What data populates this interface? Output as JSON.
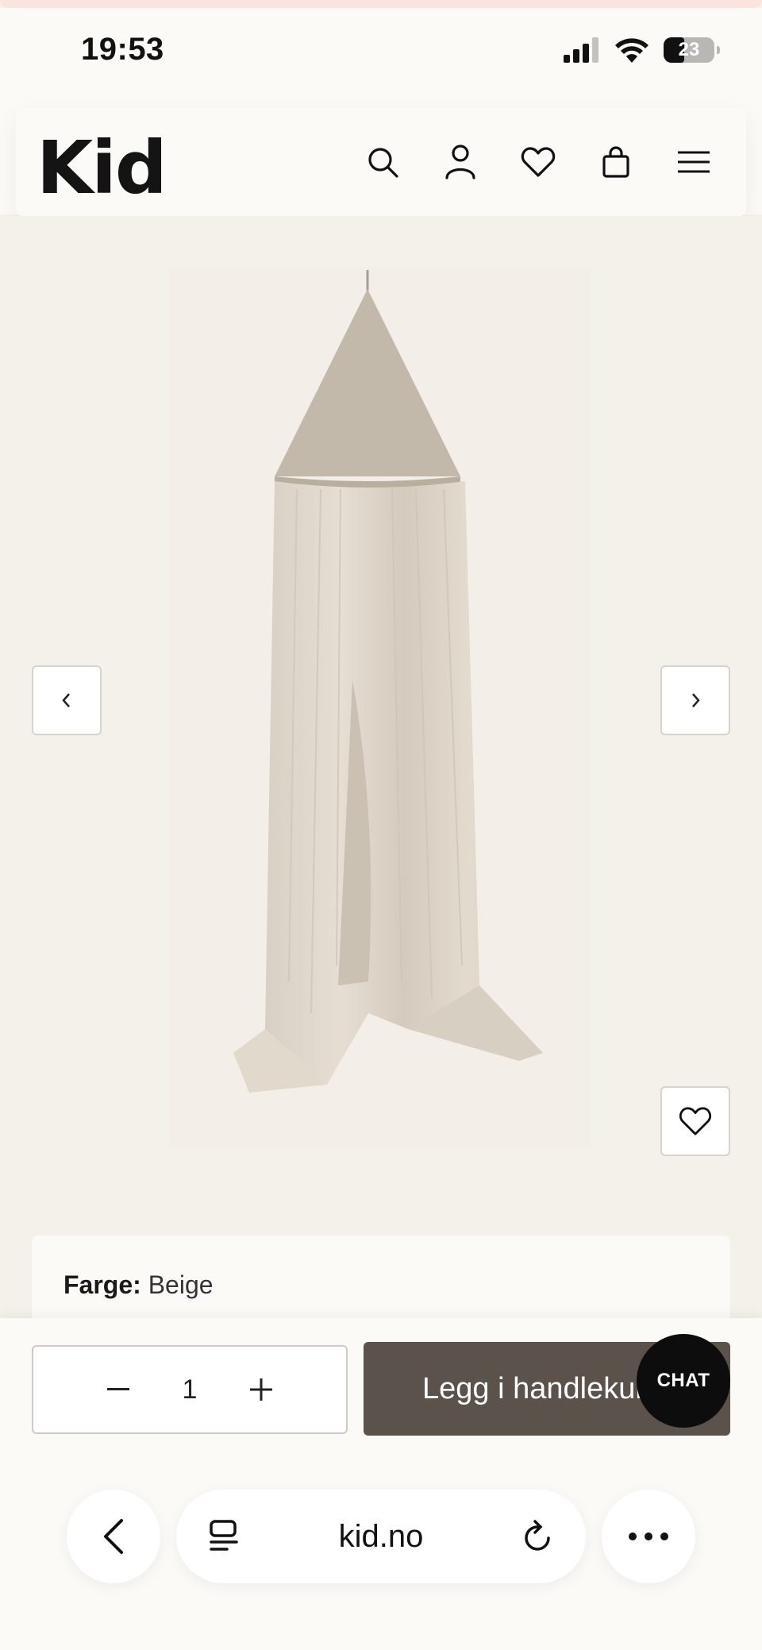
{
  "status_bar": {
    "time": "19:53",
    "battery": "23"
  },
  "header": {
    "logo": "Kid"
  },
  "product": {
    "color_label": "Farge:",
    "color_value": "Beige"
  },
  "cart": {
    "quantity": "1",
    "add_to_cart_label": "Legg i handlekurv",
    "chat_label": "CHAT"
  },
  "browser": {
    "url": "kid.no"
  }
}
